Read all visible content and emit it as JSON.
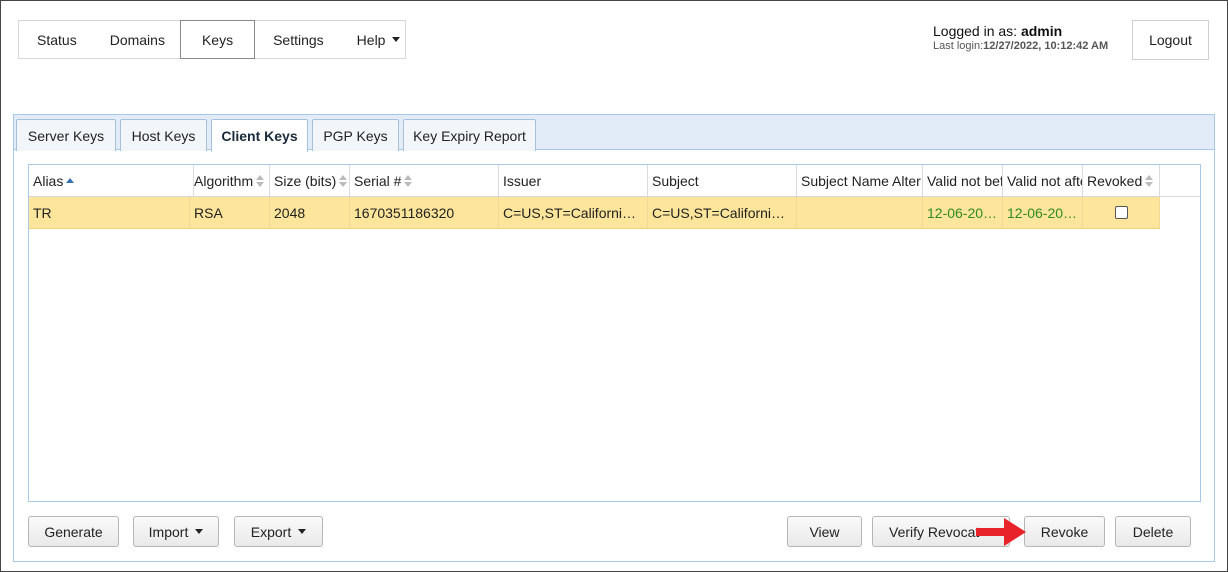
{
  "nav": {
    "items": [
      {
        "label": "Status"
      },
      {
        "label": "Domains"
      },
      {
        "label": "Keys"
      },
      {
        "label": "Settings"
      },
      {
        "label": "Help"
      }
    ],
    "active": "Keys"
  },
  "session": {
    "logged_in_prefix": "Logged in as:",
    "username": "admin",
    "last_login_prefix": "Last login:",
    "last_login": "12/27/2022, 10:12:42 AM",
    "logout_label": "Logout"
  },
  "tabs": [
    {
      "label": "Server Keys"
    },
    {
      "label": "Host Keys"
    },
    {
      "label": "Client Keys"
    },
    {
      "label": "PGP Keys"
    },
    {
      "label": "Key Expiry Report"
    }
  ],
  "active_tab": "Client Keys",
  "grid": {
    "columns": [
      {
        "label": "Alias",
        "sort": "asc"
      },
      {
        "label": "Algorithm",
        "sort": "both"
      },
      {
        "label": "Size (bits)",
        "sort": "both"
      },
      {
        "label": "Serial #",
        "sort": "both"
      },
      {
        "label": "Issuer",
        "sort": "none"
      },
      {
        "label": "Subject",
        "sort": "none"
      },
      {
        "label": "Subject Name Alter",
        "sort": "none"
      },
      {
        "label": "Valid not bef",
        "sort": "none"
      },
      {
        "label": "Valid not afte",
        "sort": "none"
      },
      {
        "label": "Revoked",
        "sort": "both"
      }
    ],
    "rows": [
      {
        "alias": "TR",
        "algorithm": "RSA",
        "size": "2048",
        "serial": "1670351186320",
        "issuer": "C=US,ST=Californi…",
        "subject": "C=US,ST=Californi…",
        "subject_alt": "",
        "valid_not_before": "12-06-20…",
        "valid_not_after": "12-06-20…",
        "revoked": false,
        "selected": true
      }
    ]
  },
  "buttons": {
    "generate": "Generate",
    "import": "Import",
    "export": "Export",
    "view": "View",
    "verify_revocation": "Verify Revocat",
    "revoke": "Revoke",
    "delete": "Delete"
  },
  "colors": {
    "selected_row": "#fde59b",
    "date_text": "#2e8b20",
    "tabbar_bg": "#e2ecf8",
    "annotation_arrow": "#e8242a"
  }
}
